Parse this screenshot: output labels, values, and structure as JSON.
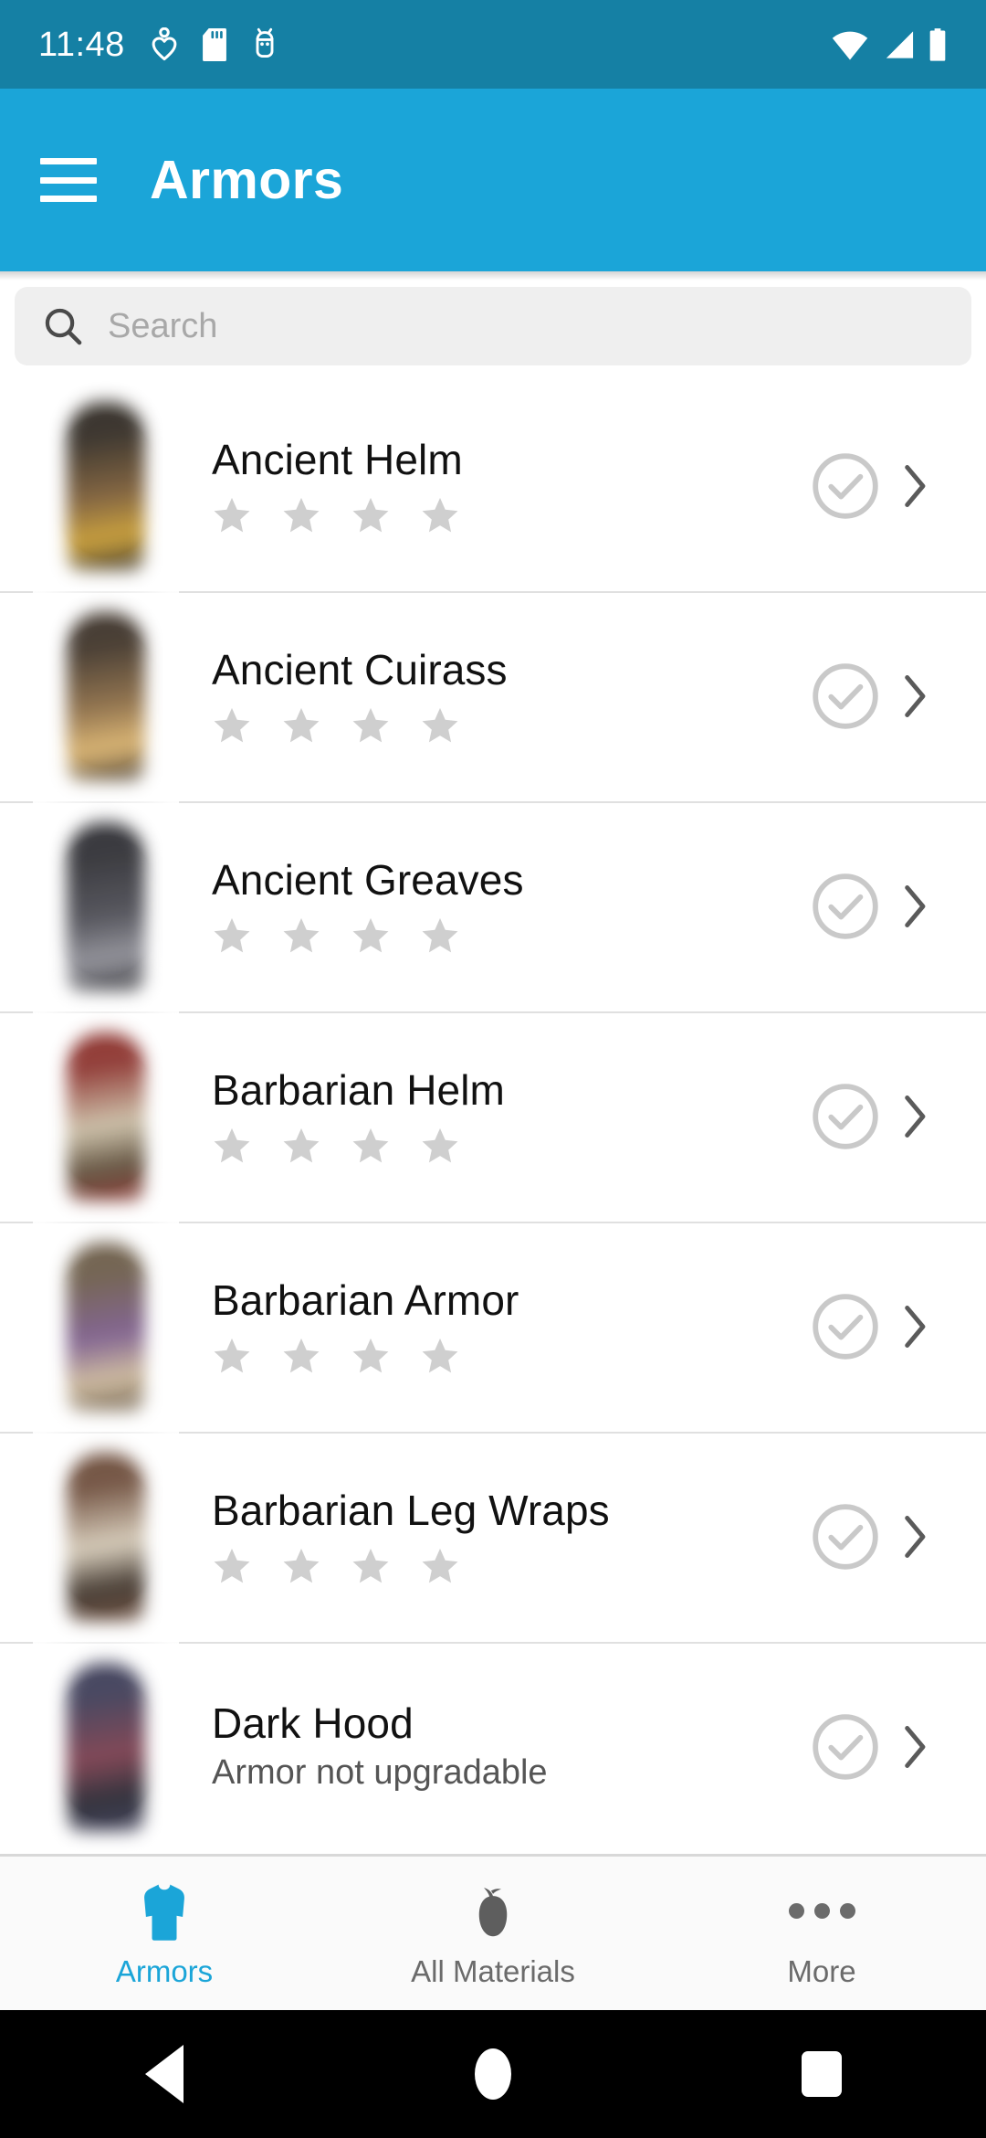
{
  "statusbar": {
    "time": "11:48",
    "icons": [
      "heart-pulse-icon",
      "sd-card-icon",
      "android-debug-icon"
    ],
    "right_icons": [
      "wifi-icon",
      "cellular-signal-icon",
      "battery-icon"
    ],
    "background": "#1580a4"
  },
  "appbar": {
    "menu_icon": "hamburger-menu-icon",
    "title": "Armors",
    "background": "#1ba5d8"
  },
  "search": {
    "icon": "search-icon",
    "value": "",
    "placeholder": "Search"
  },
  "list": {
    "items": [
      {
        "title": "Ancient Helm",
        "subtitle": "",
        "stars": 4,
        "thumb": "ancient-helm-thumbnail",
        "art_colors": [
          "#2d2720",
          "#7a5a33",
          "#c79a2e"
        ],
        "checked": true,
        "chevron": "chevron-right-icon"
      },
      {
        "title": "Ancient Cuirass",
        "subtitle": "",
        "stars": 4,
        "thumb": "ancient-cuirass-thumbnail",
        "art_colors": [
          "#3a2f25",
          "#8a6a42",
          "#d9b16a"
        ],
        "checked": true,
        "chevron": "chevron-right-icon"
      },
      {
        "title": "Ancient Greaves",
        "subtitle": "",
        "stars": 4,
        "thumb": "ancient-greaves-thumbnail",
        "art_colors": [
          "#2b2b30",
          "#4a4a52",
          "#8d8d95"
        ],
        "checked": true,
        "chevron": "chevron-right-icon"
      },
      {
        "title": "Barbarian Helm",
        "subtitle": "",
        "stars": 4,
        "thumb": "barbarian-helm-thumbnail",
        "art_colors": [
          "#8a2f2a",
          "#cbbfa6",
          "#5a4a36"
        ],
        "checked": true,
        "chevron": "chevron-right-icon"
      },
      {
        "title": "Barbarian Armor",
        "subtitle": "",
        "stars": 4,
        "thumb": "barbarian-armor-thumbnail",
        "art_colors": [
          "#6a5a46",
          "#7a5a8a",
          "#cbb79a"
        ],
        "checked": true,
        "chevron": "chevron-right-icon"
      },
      {
        "title": "Barbarian Leg Wraps",
        "subtitle": "",
        "stars": 4,
        "thumb": "barbarian-leg-wraps-thumbnail",
        "art_colors": [
          "#6b4a38",
          "#d6cbb8",
          "#3a2f26"
        ],
        "checked": true,
        "chevron": "chevron-right-icon"
      },
      {
        "title": "Dark Hood",
        "subtitle": "Armor not upgradable",
        "stars": 0,
        "thumb": "dark-hood-thumbnail",
        "art_colors": [
          "#3a3a55",
          "#7a3a4a",
          "#23232e"
        ],
        "checked": true,
        "chevron": "chevron-right-icon"
      }
    ],
    "star_color": "#cfcfcf",
    "check_color": "#c9c9c9",
    "chevron_color": "#5a5a5a"
  },
  "tabbar": {
    "tabs": [
      {
        "label": "Armors",
        "icon": "tunic-icon",
        "active": true
      },
      {
        "label": "All Materials",
        "icon": "material-icon",
        "active": false
      },
      {
        "label": "More",
        "icon": "more-dots-icon",
        "active": false
      }
    ],
    "active_color": "#1ba5d8",
    "inactive_color": "#6b6b6b"
  },
  "navbar": {
    "buttons": [
      {
        "label": "Back",
        "icon": "nav-back-icon"
      },
      {
        "label": "Home",
        "icon": "nav-home-icon"
      },
      {
        "label": "Recents",
        "icon": "nav-recents-icon"
      }
    ]
  }
}
